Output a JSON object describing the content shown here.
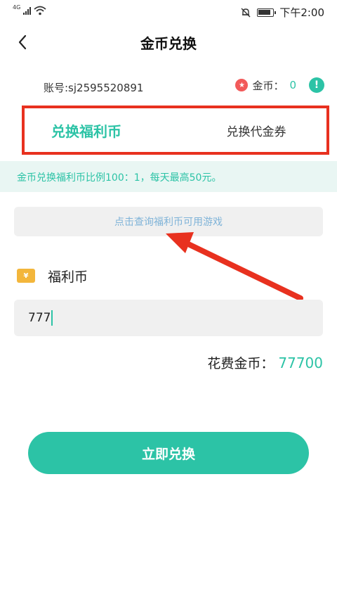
{
  "status_bar": {
    "network": "4G",
    "time": "下午2:00"
  },
  "header": {
    "title": "金币兑换"
  },
  "account": {
    "label": "账号:sj2595520891",
    "coin_label": "金币：",
    "coin_value": "0"
  },
  "tabs": [
    {
      "label": "兑换福利币",
      "active": true
    },
    {
      "label": "兑换代金券",
      "active": false
    }
  ],
  "notice": "金币兑换福利币比例100：1，每天最高50元。",
  "query_button": "点击查询福利币可用游戏",
  "welfare": {
    "label": "福利币",
    "input_value": "777"
  },
  "cost": {
    "label": "花费金币：",
    "value": "77700"
  },
  "submit_label": "立即兑换",
  "colors": {
    "accent": "#2cc3a6",
    "annotation_red": "#e8311f",
    "coin_red": "#f25a5a",
    "ticket_gold": "#f3b63b",
    "notice_bg": "#e9f6f3"
  }
}
